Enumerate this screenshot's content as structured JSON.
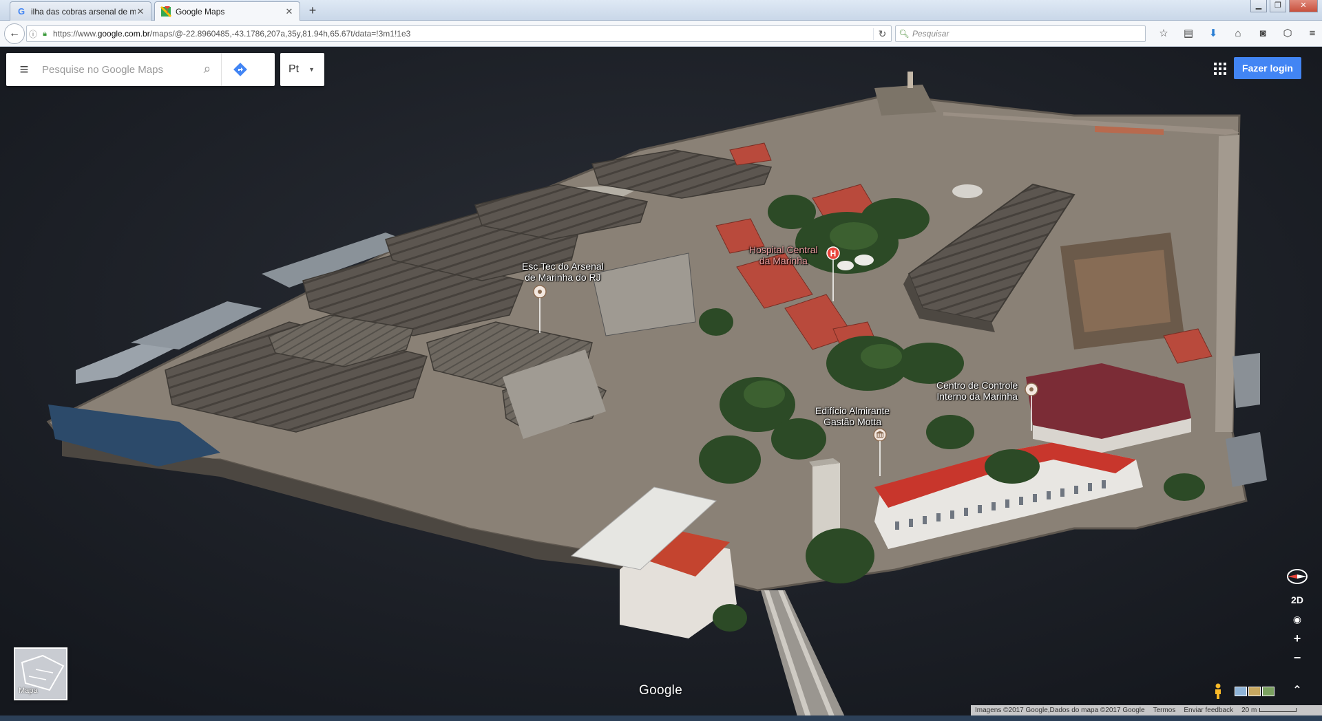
{
  "browser": {
    "tabs": [
      {
        "title": "ilha das cobras arsenal de ma",
        "icon": "google-g-icon",
        "active": false
      },
      {
        "title": "Google Maps",
        "icon": "google-maps-icon",
        "active": true
      }
    ],
    "new_tab_label": "+",
    "back_label": "←",
    "url_prefix": "https://www.",
    "url_domain": "google.com.br",
    "url_rest": "/maps/@-22.8960485,-43.1786,207a,35y,81.94h,65.67t/data=!3m1!1e3",
    "search_placeholder": "Pesquisar",
    "toolbar_icons": [
      "star-icon",
      "reading-list-icon",
      "download-icon",
      "home-icon",
      "pocket-icon",
      "shield-icon",
      "hamburger-menu-icon"
    ]
  },
  "maps": {
    "search_placeholder": "Pesquise no Google Maps",
    "language": "Pt",
    "login_label": "Fazer login",
    "places": [
      {
        "name": "Esc Tec do Arsenal\nde Marinha do RJ",
        "icon": "pin-icon",
        "color": "#ffffff"
      },
      {
        "name": "Hospital Central\nda Marinha",
        "icon": "hospital-icon",
        "color": "#f1a3a3"
      },
      {
        "name": "Centro de Controle\nInterno da Marinha",
        "icon": "pin-icon",
        "color": "#ffffff"
      },
      {
        "name": "Edifício Almirante\nGastão Motta",
        "icon": "museum-icon",
        "color": "#ffffff"
      }
    ],
    "view_toggle": "2D",
    "zoom_in": "+",
    "zoom_out": "−",
    "expand": "⌃",
    "minimap_label": "Mapa",
    "logo": "Google",
    "footer": {
      "attribution": "Imagens ©2017 Google,Dados do mapa ©2017 Google",
      "terms": "Termos",
      "feedback": "Enviar feedback",
      "scale": "20 m"
    }
  }
}
